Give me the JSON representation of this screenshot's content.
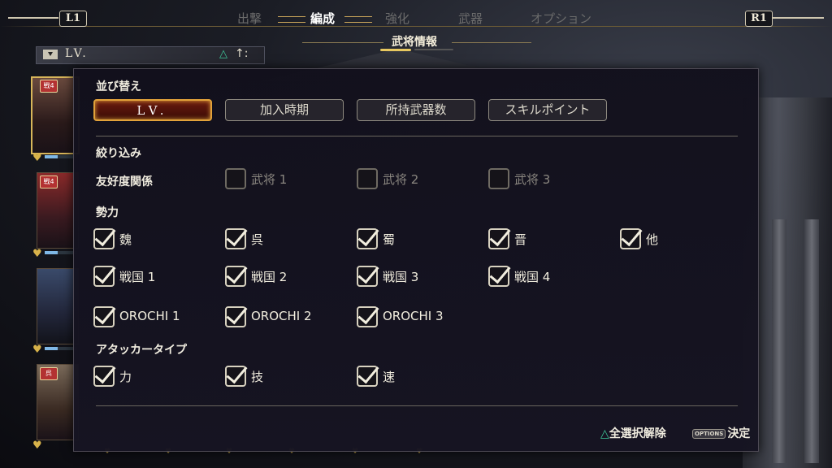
{
  "top_nav": {
    "left_button": "L1",
    "right_button": "R1",
    "tabs": [
      "出撃",
      "編成",
      "強化",
      "武器",
      "オプション"
    ],
    "active_tab": "編成"
  },
  "subtitle": "武将情報",
  "sort_bar": {
    "value": "LV.",
    "triangle": "△",
    "updown": "↑:"
  },
  "characters": [
    {
      "badge": "戦4",
      "selected": true,
      "bond_fraction": 0.4
    },
    {
      "badge": "戦4",
      "selected": false,
      "bond_fraction": 0.3
    },
    {
      "badge": "",
      "selected": false,
      "bond_fraction": 0.3
    },
    {
      "badge": "呉",
      "selected": false,
      "bond_fraction": 0.3
    }
  ],
  "panel": {
    "sort_heading": "並び替え",
    "sort_options": [
      "LV.",
      "加入時期",
      "所持武器数",
      "スキルポイント"
    ],
    "sort_active_index": 0,
    "filter_heading": "絞り込み",
    "affinity_label": "友好度関係",
    "affinity_options": [
      {
        "label": "武将 1",
        "checked": false
      },
      {
        "label": "武将 2",
        "checked": false
      },
      {
        "label": "武将 3",
        "checked": false
      }
    ],
    "faction_label": "勢力",
    "faction_row1": [
      {
        "label": "魏",
        "checked": true
      },
      {
        "label": "呉",
        "checked": true
      },
      {
        "label": "蜀",
        "checked": true
      },
      {
        "label": "晋",
        "checked": true
      },
      {
        "label": "他",
        "checked": true
      }
    ],
    "faction_row2": [
      {
        "label": "戦国 1",
        "checked": true
      },
      {
        "label": "戦国 2",
        "checked": true
      },
      {
        "label": "戦国 3",
        "checked": true
      },
      {
        "label": "戦国 4",
        "checked": true
      }
    ],
    "faction_row3": [
      {
        "label": "OROCHI 1",
        "checked": true
      },
      {
        "label": "OROCHI 2",
        "checked": true
      },
      {
        "label": "OROCHI 3",
        "checked": true
      }
    ],
    "attacker_label": "アタッカータイプ",
    "attacker_options": [
      {
        "label": "力",
        "checked": true
      },
      {
        "label": "技",
        "checked": true
      },
      {
        "label": "速",
        "checked": true
      }
    ],
    "footer": {
      "deselect_icon": "△",
      "deselect_label": "全選択解除",
      "confirm_icon": "OPTIONS",
      "confirm_label": "決定"
    }
  },
  "colors": {
    "accent_gold": "#d8b65a",
    "active_button": "#6a1a0e",
    "triangle_green": "#3fc99a"
  }
}
